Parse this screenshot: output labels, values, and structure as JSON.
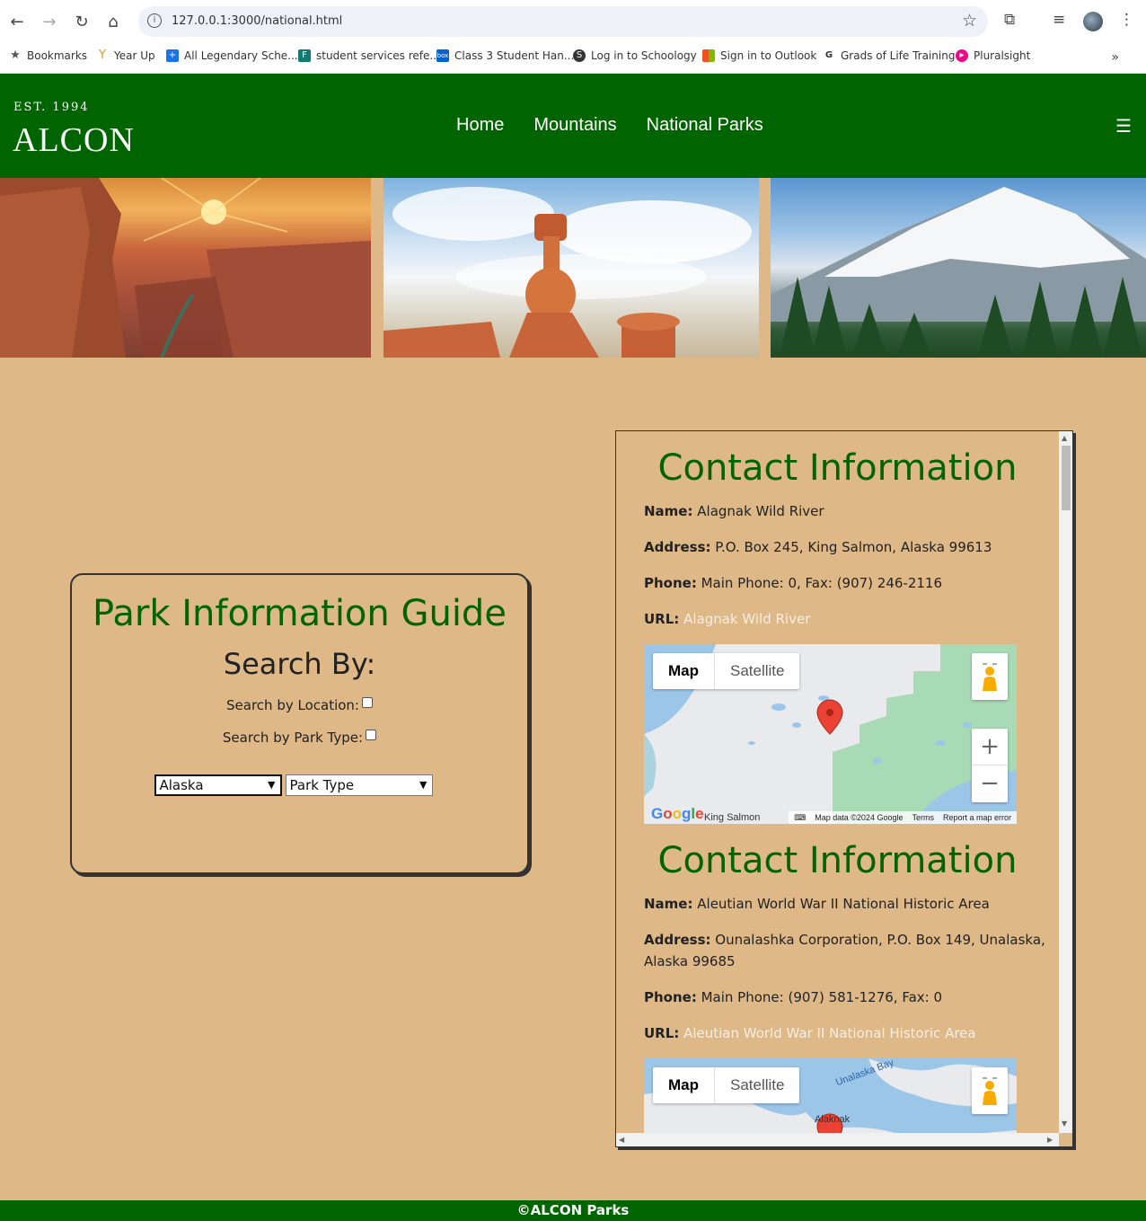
{
  "browser": {
    "url": "127.0.0.1:3000/national.html",
    "bookmarks": [
      {
        "label": "Bookmarks",
        "icon": "star-icon"
      },
      {
        "label": "Year Up",
        "icon": "yearup-icon"
      },
      {
        "label": "All Legendary Sche...",
        "icon": "plus-icon"
      },
      {
        "label": "student services refe...",
        "icon": "forms-icon"
      },
      {
        "label": "Class 3 Student Han...",
        "icon": "box-icon"
      },
      {
        "label": "Log in to Schoology",
        "icon": "schoology-icon"
      },
      {
        "label": "Sign in to Outlook",
        "icon": "microsoft-icon"
      },
      {
        "label": "Grads of Life Training",
        "icon": "g-icon"
      },
      {
        "label": "Pluralsight",
        "icon": "pluralsight-icon"
      }
    ]
  },
  "header": {
    "est": "EST. 1994",
    "logo": "ALCON",
    "nav": [
      "Home",
      "Mountains",
      "National Parks"
    ],
    "menu_icon": "hamburger-icon"
  },
  "guide": {
    "title": "Park Information Guide",
    "subtitle": "Search By:",
    "by_location_label": "Search by Location:",
    "by_type_label": "Search by Park Type:",
    "location_value": "Alaska",
    "type_value": "Park Type"
  },
  "contacts": [
    {
      "heading": "Contact Information",
      "name_label": "Name:",
      "name": "Alagnak Wild River",
      "address_label": "Address:",
      "address": "P.O. Box 245, King Salmon, Alaska 99613",
      "phone_label": "Phone:",
      "phone": "Main Phone: 0, Fax: (907) 246-2116",
      "url_label": "URL:",
      "url": "Alagnak Wild River",
      "map_place": "King Salmon"
    },
    {
      "heading": "Contact Information",
      "name_label": "Name:",
      "name": "Aleutian World War II National Historic Area",
      "address_label": "Address:",
      "address": "Ounalashka Corporation, P.O. Box 149, Unalaska, Alaska 99685",
      "phone_label": "Phone:",
      "phone": "Main Phone: (907) 581-1276, Fax: 0",
      "url_label": "URL:",
      "url": "Aleutian World War II National Historic Area",
      "map_place": "Unalaska Bay",
      "map_place2": "Alaknak"
    }
  ],
  "map": {
    "map_label": "Map",
    "satellite_label": "Satellite",
    "zoom_in": "+",
    "zoom_out": "−",
    "google": [
      "G",
      "o",
      "o",
      "g",
      "l",
      "e"
    ],
    "data_text": "Map data ©2024 Google",
    "terms": "Terms",
    "report": "Report a map error"
  },
  "footer": {
    "text": "©ALCON Parks"
  },
  "colors": {
    "green": "#006400",
    "tan": "#DEB887"
  }
}
